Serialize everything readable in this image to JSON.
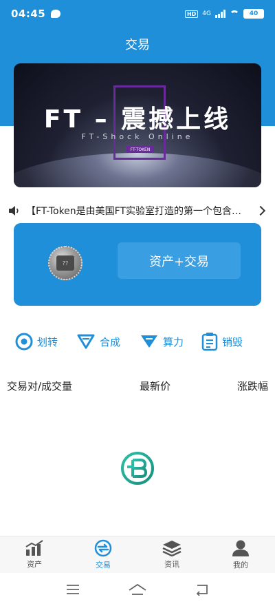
{
  "status": {
    "time": "04:45",
    "hd": "HD",
    "net": "4G",
    "battery": "40"
  },
  "header": {
    "title": "交易"
  },
  "banner": {
    "headline": "FT – 震撼上线",
    "subline": "FT-Shock Online",
    "tag": "FT-TOKEN"
  },
  "notice": {
    "text": "【FT-Token是由美国FT实验室打造的第一个包含…"
  },
  "asset_card": {
    "button_label": "资产+交易",
    "coin_text": "??"
  },
  "actions": [
    {
      "label": "划转",
      "icon": "chrome-like-circle-icon"
    },
    {
      "label": "合成",
      "icon": "diamond-outline-icon"
    },
    {
      "label": "算力",
      "icon": "diamond-filled-icon"
    },
    {
      "label": "销毁",
      "icon": "clipboard-list-icon"
    }
  ],
  "market": {
    "col_pair": "交易对/成交量",
    "col_price": "最新价",
    "col_change": "涨跌幅"
  },
  "tabbar": [
    {
      "label": "资产",
      "icon": "chart-icon",
      "active": false
    },
    {
      "label": "交易",
      "icon": "exchange-icon",
      "active": true
    },
    {
      "label": "资讯",
      "icon": "layers-icon",
      "active": false
    },
    {
      "label": "我的",
      "icon": "user-icon",
      "active": false
    }
  ],
  "colors": {
    "primary": "#1e8fd8",
    "banner_accent": "#6a2b9a",
    "tab_inactive": "#555555"
  }
}
